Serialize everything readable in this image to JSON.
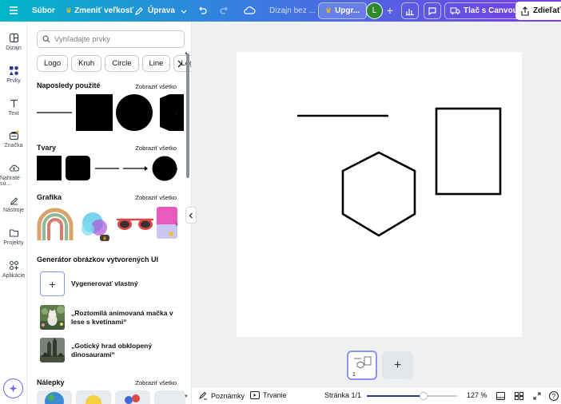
{
  "topbar": {
    "file_label": "Súbor",
    "resize_label": "Zmeniť veľkosť",
    "edit_label": "Úprava",
    "design_title": "Dizajn bez ...",
    "upgrade_label": "Upgr...",
    "avatar_letter": "L",
    "print_label": "Tlač s Canvou",
    "share_label": "Zdieľať"
  },
  "rail": {
    "items": [
      {
        "label": "Dizajn",
        "icon": "layout-icon"
      },
      {
        "label": "Prvky",
        "icon": "elements-icon"
      },
      {
        "label": "Text",
        "icon": "text-icon"
      },
      {
        "label": "Značka",
        "icon": "brand-icon"
      },
      {
        "label": "Nahraté sú...",
        "icon": "upload-icon"
      },
      {
        "label": "Nástroje",
        "icon": "tools-icon"
      },
      {
        "label": "Projekty",
        "icon": "folder-icon"
      },
      {
        "label": "Aplikácie",
        "icon": "apps-icon"
      }
    ]
  },
  "panel": {
    "search_placeholder": "Vyhľadajte prvky",
    "chips": [
      "Logo",
      "Kruh",
      "Circle",
      "Line",
      "Logo"
    ],
    "recent": {
      "title": "Naposledy použité",
      "link": "Zobraziť všetko"
    },
    "shapes": {
      "title": "Tvary",
      "link": "Zobraziť všetko"
    },
    "graphics": {
      "title": "Grafika",
      "link": "Zobraziť všetko"
    },
    "generator": {
      "title": "Generátor obrázkov vytvorených UI",
      "create_label": "Vygenerovať vlastný",
      "items": [
        "„Roztomilá animovaná mačka v lese s kvetinami“",
        "„Gotický hrad obklopený dinosaurami“"
      ]
    },
    "stickers": {
      "title": "Nálepky",
      "link": "Zobraziť všetko"
    }
  },
  "canvas": {
    "page_number": "1"
  },
  "bottombar": {
    "notes_label": "Poznámky",
    "duration_label": "Trvanie",
    "page_label": "Stránka 1/1",
    "zoom_label": "127 %",
    "zoom_level_fraction": 0.63,
    "help_label": "?"
  },
  "colors": {
    "accent": "#2d3a8c",
    "topbar_start": "#00b6c9",
    "topbar_end": "#7a3be6"
  }
}
